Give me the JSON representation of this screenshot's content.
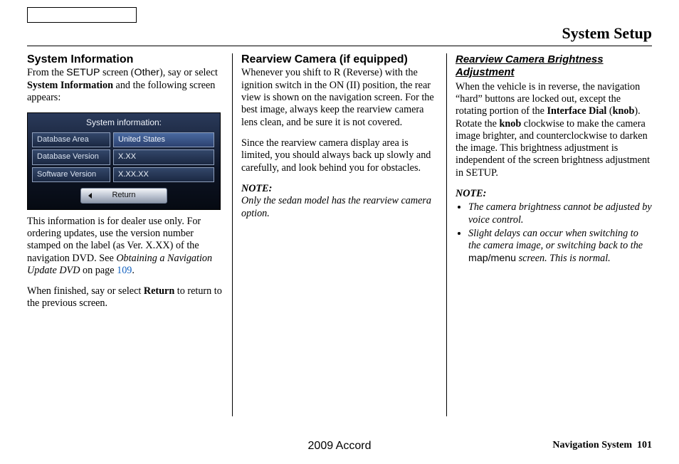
{
  "pageTitle": "System Setup",
  "col1": {
    "heading": "System Information",
    "intro_1": "From the ",
    "intro_setup": "SETUP",
    "intro_2": " screen (",
    "intro_other": "Other",
    "intro_3": "), say or select ",
    "intro_sysinfo": "System Information",
    "intro_4": " and the following screen appears:",
    "screen": {
      "title": "System information:",
      "rows": [
        {
          "label": "Database Area",
          "value": "United States",
          "selected": true
        },
        {
          "label": "Database Version",
          "value": "X.XX",
          "selected": false
        },
        {
          "label": "Software Version",
          "value": "X.XX.XX",
          "selected": false
        }
      ],
      "returnLabel": "Return"
    },
    "dealer_1": "This information is for dealer use only. For ordering updates, use the version number stamped on the label (as Ver. X.XX) of the navigation DVD. See ",
    "dealer_ref_i": "Obtaining a Navigation Update DVD",
    "dealer_2": " on page ",
    "dealer_page": "109",
    "dealer_3": ".",
    "finish_1": "When finished, say or select ",
    "finish_return": "Return",
    "finish_2": " to return to the previous screen."
  },
  "col2": {
    "heading": "Rearview Camera (if equipped)",
    "p1": "Whenever you shift to R (Reverse) with the ignition switch in the ON (II) position, the rear view is shown on the navigation screen. For the best image, always keep the rearview camera lens clean, and be sure it is not covered.",
    "p2": "Since the rearview camera display area is limited, you should always back up slowly and carefully, and look behind you for obstacles.",
    "noteLabel": "NOTE:",
    "noteBody": "Only the sedan model has the rearview camera option."
  },
  "col3": {
    "heading": "Rearview Camera Brightness Adjustment",
    "p_a": "When the vehicle is in reverse, the navigation “hard” buttons are locked out, except the rotating portion of the ",
    "p_id": "Interface Dial",
    "p_b": " (",
    "p_knob1": "knob",
    "p_c": "). Rotate the ",
    "p_knob2": "knob",
    "p_d": " clockwise to make the camera image brighter, and counterclockwise to darken the image. This brightness adjustment is independent of the screen brightness adjustment in SETUP.",
    "noteLabel": "NOTE:",
    "bullet1": "The camera brightness cannot be adjusted by voice control.",
    "bullet2_a": "Slight delays can occur when switching to the camera image, or switching back to the ",
    "bullet2_mm": "map/menu",
    "bullet2_b": " screen. This is normal."
  },
  "footer": {
    "center": "2009  Accord",
    "rightLabel": "Navigation System",
    "pageNum": "101"
  }
}
